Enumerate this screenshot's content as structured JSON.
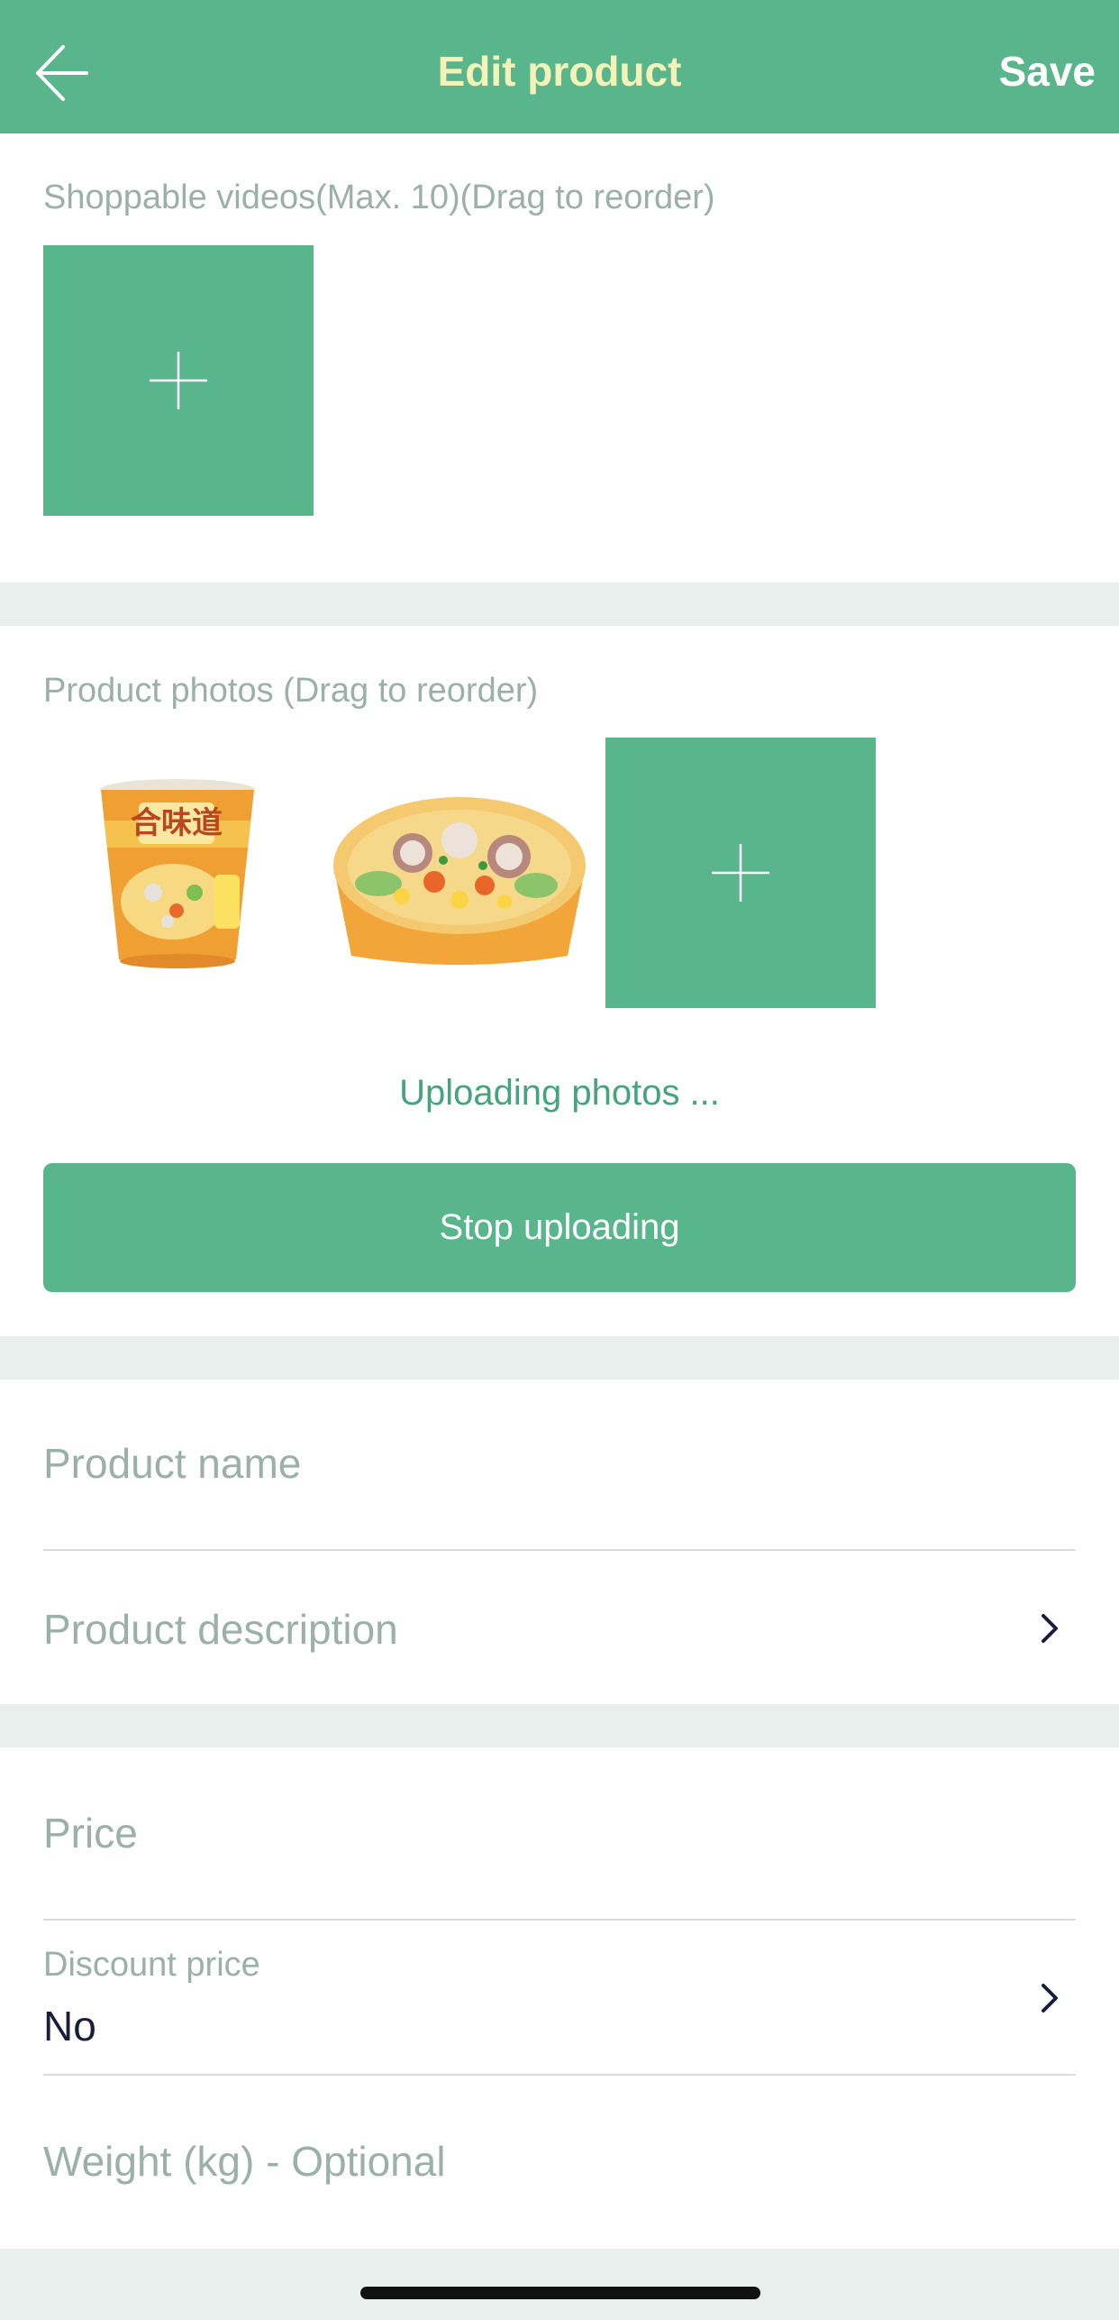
{
  "header": {
    "title": "Edit product",
    "save_label": "Save",
    "back_icon": "arrow-left-icon",
    "background": "#58b58c"
  },
  "videos": {
    "label": "Shoppable videos(Max. 10)(Drag to reorder)",
    "add_icon": "plus-icon"
  },
  "photos": {
    "label": "Product photos (Drag to reorder)",
    "items": [
      {
        "name": "product-photo-cup"
      },
      {
        "name": "product-photo-bowl"
      }
    ],
    "add_icon": "plus-icon",
    "status": "Uploading photos ...",
    "stop_label": "Stop uploading"
  },
  "details": {
    "name_placeholder": "Product name",
    "description_placeholder": "Product description"
  },
  "pricing": {
    "price_placeholder": "Price",
    "discount_label": "Discount price",
    "discount_value": "No",
    "weight_placeholder": "Weight (kg) - Optional"
  },
  "colors": {
    "accent": "#58b58c",
    "title": "#f5f2b8",
    "muted_text": "#9ab0a8",
    "band": "#e8efec"
  }
}
